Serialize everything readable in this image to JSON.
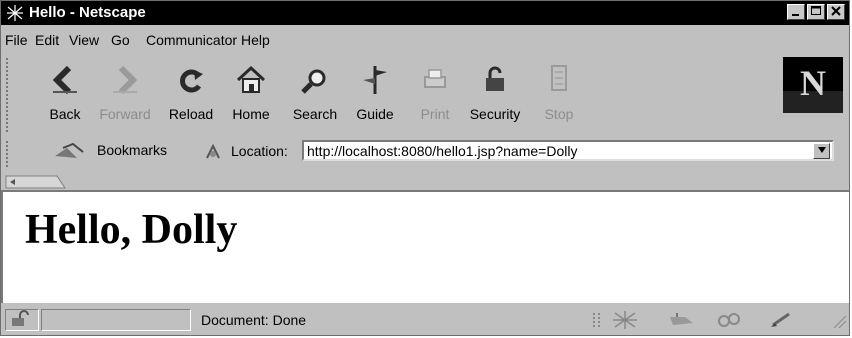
{
  "window": {
    "title": "Hello - Netscape"
  },
  "menubar": {
    "items": [
      "File",
      "Edit",
      "View",
      "Go",
      "Communicator",
      "Help"
    ]
  },
  "toolbar": {
    "buttons": [
      {
        "label": "Back",
        "icon": "back-arrow-icon",
        "enabled": true
      },
      {
        "label": "Forward",
        "icon": "forward-arrow-icon",
        "enabled": false
      },
      {
        "label": "Reload",
        "icon": "reload-icon",
        "enabled": true
      },
      {
        "label": "Home",
        "icon": "home-icon",
        "enabled": true
      },
      {
        "label": "Search",
        "icon": "search-icon",
        "enabled": true
      },
      {
        "label": "Guide",
        "icon": "guide-icon",
        "enabled": true
      },
      {
        "label": "Print",
        "icon": "print-icon",
        "enabled": false
      },
      {
        "label": "Security",
        "icon": "lock-icon",
        "enabled": true
      },
      {
        "label": "Stop",
        "icon": "stop-icon",
        "enabled": false
      }
    ]
  },
  "location_bar": {
    "bookmarks_label": "Bookmarks",
    "location_label": "Location:",
    "url": "http://localhost:8080/hello1.jsp?name=Dolly"
  },
  "content": {
    "heading": "Hello, Dolly"
  },
  "status": {
    "text": "Document: Done"
  },
  "colors": {
    "titlebar": "#000000",
    "chrome": "#c0c0c0",
    "page": "#ffffff",
    "disabled_text": "#8c8c8c"
  }
}
